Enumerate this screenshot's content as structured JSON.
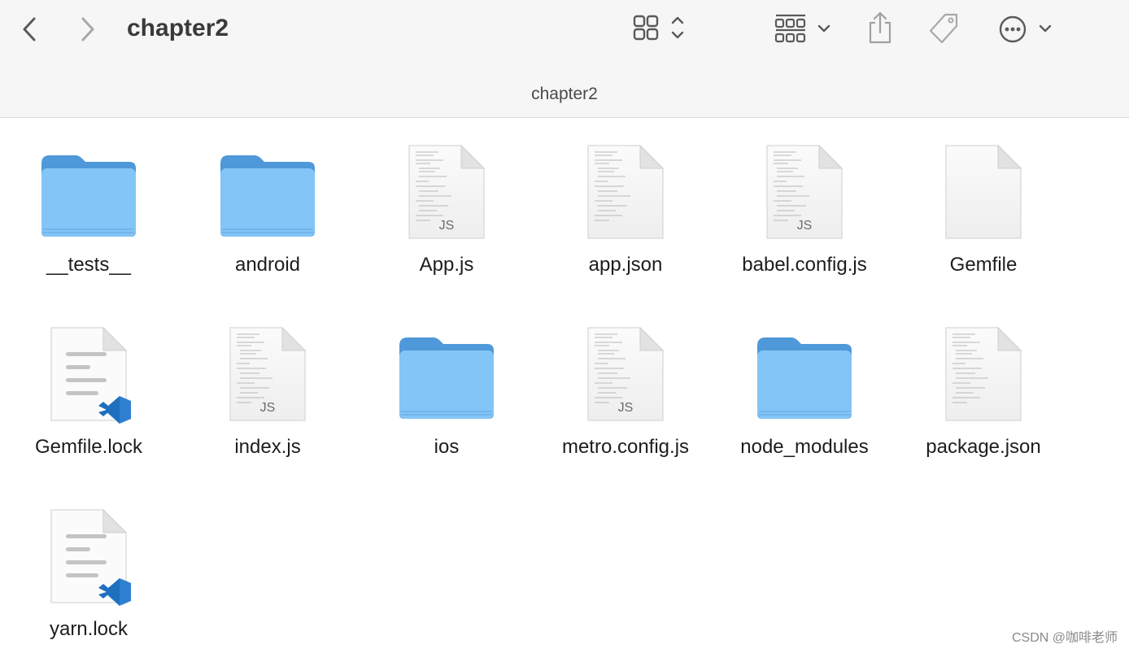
{
  "toolbar": {
    "title": "chapter2",
    "back_icon": "chevron-left-icon",
    "forward_icon": "chevron-right-icon",
    "view_icon": "icon-grid-view-icon",
    "group_icon": "group-by-icon",
    "share_icon": "share-icon",
    "tag_icon": "tag-icon",
    "more_icon": "ellipsis-circle-icon"
  },
  "path_bar": {
    "title": "chapter2"
  },
  "files": [
    {
      "name": "__tests__",
      "kind": "folder"
    },
    {
      "name": "android",
      "kind": "folder"
    },
    {
      "name": "App.js",
      "kind": "js-doc"
    },
    {
      "name": "app.json",
      "kind": "doc"
    },
    {
      "name": "babel.config.js",
      "kind": "js-doc"
    },
    {
      "name": "Gemfile",
      "kind": "blank-doc"
    },
    {
      "name": "Gemfile.lock",
      "kind": "vscode-doc"
    },
    {
      "name": "index.js",
      "kind": "js-doc"
    },
    {
      "name": "ios",
      "kind": "folder"
    },
    {
      "name": "metro.config.js",
      "kind": "js-doc"
    },
    {
      "name": "node_modules",
      "kind": "folder"
    },
    {
      "name": "package.json",
      "kind": "doc"
    },
    {
      "name": "yarn.lock",
      "kind": "vscode-doc"
    }
  ],
  "badges": {
    "js": "JS"
  },
  "colors": {
    "folder": "#80c4f6",
    "folder_tab": "#5aa3e0",
    "vscode": "#2f80d0"
  },
  "watermark": "CSDN @咖啡老师"
}
